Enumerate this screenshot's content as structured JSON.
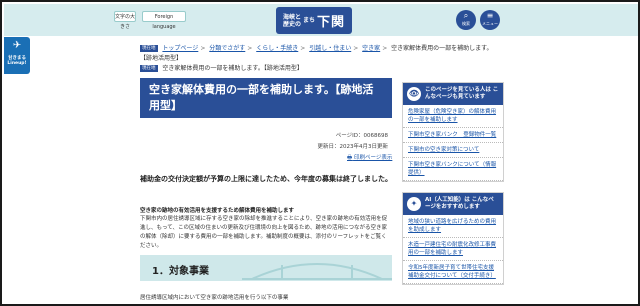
{
  "header": {
    "text_size_label": "文字の大きさ",
    "foreign_language_label": "Foreign language",
    "logo_small_line1": "海峡と",
    "logo_small_line2": "歴史の",
    "logo_small_line3": "まち",
    "logo_big": "下関",
    "search_label": "検索",
    "menu_label": "メニュー"
  },
  "lineup": {
    "line1": "甘きまる",
    "line2": "Lineup!"
  },
  "breadcrumb": {
    "tag": "現在地",
    "items": [
      "トップページ",
      "分類でさがす",
      "くらし・手続き",
      "引越し・住まい",
      "空き家",
      "空き家解体費用の一部を補助します。【跡地活用型】"
    ],
    "current_tag": "現在地",
    "current": "空き家解体費用の一部を補助します。【跡地活用型】"
  },
  "title": "空き家解体費用の一部を補助します。【跡地活用型】",
  "meta": {
    "page_id": "ページID：0068698",
    "updated": "更新日：2023年4月3日更新",
    "print": "印刷ページ表示"
  },
  "notice": "補助金の交付決定額が予算の上限に達したため、今年度の募集は終了しました。",
  "subhead": "空き家の跡地の有効活用を支援するため解体費用を補助します",
  "paragraph": "下関市内の居住誘導区域に存する空き家の除却を推進することにより、空き家の跡地の有効活用を促進し、もって、この区域の住まいの更新及び住環境の向上を図るため、跡地の活用につながる空き家の解体（除却）に要する費用の一部を補助します。補助制度の概要は、添付のリーフレットをご覧ください。",
  "section1": "1．対象事業",
  "lastline": "居住誘導区域内において空き家の跡地活用を行う以下の事業",
  "sidebar": {
    "box1_title": "このページを見ている人は こんなページも見ています",
    "box1_items": [
      "危険家屋（危険空き家）の解体費用の一部を補助します",
      "下関市空き家バンク　登録物件一覧",
      "下関市の空き家対策について",
      "下関市空き家バンクについて（情報提供）"
    ],
    "box2_title": "AI（人工知能）は こんなページをおすすめします",
    "box2_items": [
      "地域の狭い道路を広げるための費用を助成します",
      "木造一戸建住宅の耐震化改修工事費用の一部を補助します",
      "令和5年度新居子育て世帯住宅支援補助金交付について（交付手続き）"
    ]
  }
}
